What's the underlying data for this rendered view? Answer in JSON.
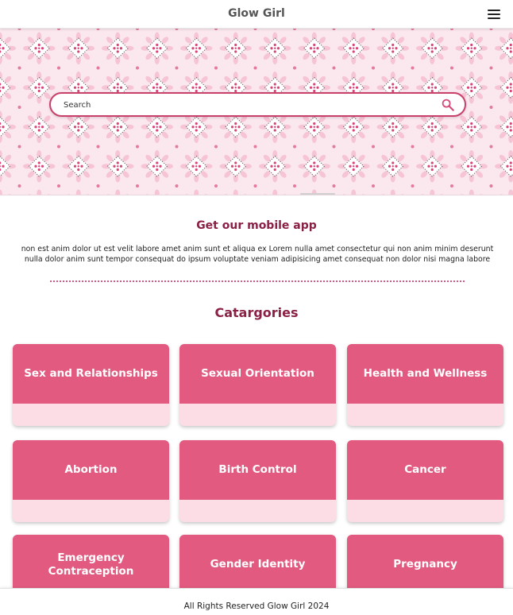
{
  "app": {
    "title": "Glow Girl",
    "menu_icon": "hamburger-menu-icon"
  },
  "search": {
    "placeholder": "Search",
    "value": "",
    "icon": "search-icon"
  },
  "app_section": {
    "title": "Get our mobile app",
    "description": "non est anim dolor ut est velit labore amet anim sunt et aliqua ex Lorem nulla amet consectetur qui non anim minim deserunt nulla dolor anim sunt tempor consequat do ipsum voluptate veniam adipisicing amet consequat non dolor nisi magna labore"
  },
  "categories_section": {
    "title": "Catargories",
    "items": [
      {
        "label": "Sex and Relationships"
      },
      {
        "label": "Sexual Orientation"
      },
      {
        "label": "Health and Wellness"
      },
      {
        "label": "Abortion"
      },
      {
        "label": "Birth Control"
      },
      {
        "label": "Cancer"
      },
      {
        "label": "Emergency Contraception"
      },
      {
        "label": "Gender Identity"
      },
      {
        "label": "Pregnancy"
      }
    ]
  },
  "footer": {
    "text": "All Rights Reserved Glow Girl 2024"
  },
  "colors": {
    "brand_dark": "#8b2046",
    "card_primary": "#e25a80",
    "card_secondary": "#fcdde6",
    "hero_background": "#fbe7ee",
    "search_border": "#c9406b"
  }
}
